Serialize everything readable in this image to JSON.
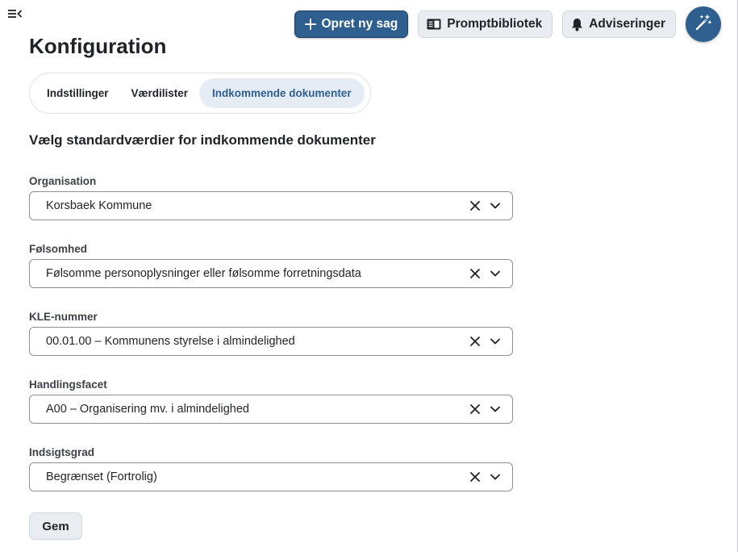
{
  "header": {
    "new_case_label": "Opret ny sag",
    "prompt_library_label": "Promptbibliotek",
    "notifications_label": "Adviseringer",
    "icons": [
      "menu-collapse-icon",
      "plus-icon",
      "book-icon",
      "bell-icon",
      "magic-wand-icon"
    ]
  },
  "page": {
    "title": "Konfiguration"
  },
  "tabs": [
    {
      "label": "Indstillinger",
      "active": false
    },
    {
      "label": "Værdilister",
      "active": false
    },
    {
      "label": "Indkommende dokumenter",
      "active": true
    }
  ],
  "section": {
    "heading": "Vælg standardværdier for indkommende dokumenter"
  },
  "fields": [
    {
      "label": "Organisation",
      "value": "Korsbaek Kommune"
    },
    {
      "label": "Følsomhed",
      "value": "Følsomme personoplysninger eller følsomme forretningsdata"
    },
    {
      "label": "KLE-nummer",
      "value": "00.01.00 – Kommunens styrelse i almindelighed"
    },
    {
      "label": "Handlingsfacet",
      "value": "A00 – Organisering mv. i almindelighed"
    },
    {
      "label": "Indsigtsgrad",
      "value": "Begrænset (Fortrolig)"
    }
  ],
  "actions": {
    "save_label": "Gem"
  },
  "colors": {
    "primary": "#2f5f8f",
    "secondary_bg": "#e9edf1",
    "active_tab_bg": "#e6ecf3"
  }
}
